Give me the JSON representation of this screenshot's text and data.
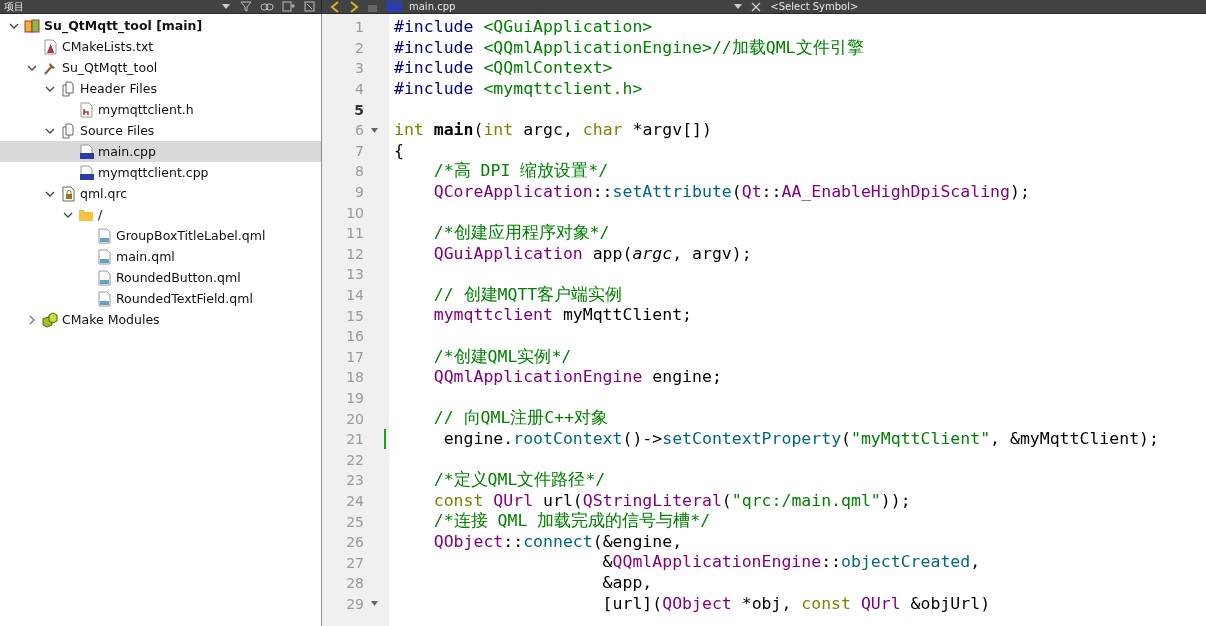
{
  "toolbar": {
    "panel_title": "项目",
    "file_tab": "main.cpp",
    "symbol_selector": "<Select Symbol>"
  },
  "tree": [
    {
      "label": "Su_QtMqtt_tool [main]",
      "kind": "project",
      "expanded": true,
      "selected": false,
      "children": [
        {
          "label": "CMakeLists.txt",
          "kind": "cmake",
          "selected": false
        },
        {
          "label": "Su_QtMqtt_tool",
          "kind": "target",
          "expanded": true,
          "selected": false,
          "children": [
            {
              "label": "Header Files",
              "kind": "group",
              "expanded": true,
              "selected": false,
              "children": [
                {
                  "label": "mymqttclient.h",
                  "kind": "header",
                  "selected": false
                }
              ]
            },
            {
              "label": "Source Files",
              "kind": "group",
              "expanded": true,
              "selected": false,
              "children": [
                {
                  "label": "main.cpp",
                  "kind": "source",
                  "selected": true
                },
                {
                  "label": "mymqttclient.cpp",
                  "kind": "source",
                  "selected": false
                }
              ]
            },
            {
              "label": "qml.qrc",
              "kind": "resource",
              "expanded": true,
              "selected": false,
              "children": [
                {
                  "label": "/",
                  "kind": "folder",
                  "expanded": true,
                  "selected": false,
                  "children": [
                    {
                      "label": "GroupBoxTitleLabel.qml",
                      "kind": "qml",
                      "selected": false
                    },
                    {
                      "label": "main.qml",
                      "kind": "qml",
                      "selected": false
                    },
                    {
                      "label": "RoundedButton.qml",
                      "kind": "qml",
                      "selected": false
                    },
                    {
                      "label": "RoundedTextField.qml",
                      "kind": "qml",
                      "selected": false
                    }
                  ]
                }
              ]
            }
          ]
        },
        {
          "label": "CMake Modules",
          "kind": "modules",
          "expanded": false,
          "selected": false
        }
      ]
    }
  ],
  "code_lines": [
    {
      "number": "1",
      "tokens": [
        {
          "kind": "pre",
          "text": "#include "
        },
        {
          "kind": "str",
          "text": "<QGuiApplication>"
        }
      ]
    },
    {
      "number": "2",
      "tokens": [
        {
          "kind": "pre",
          "text": "#include "
        },
        {
          "kind": "str",
          "text": "<QQmlApplicationEngine>//加载QML文件引擎"
        }
      ]
    },
    {
      "number": "3",
      "tokens": [
        {
          "kind": "pre",
          "text": "#include "
        },
        {
          "kind": "str",
          "text": "<QQmlContext>"
        }
      ]
    },
    {
      "number": "4",
      "tokens": [
        {
          "kind": "pre",
          "text": "#include "
        },
        {
          "kind": "str",
          "text": "<mymqttclient.h>"
        }
      ]
    },
    {
      "number": "5",
      "current": true
    },
    {
      "number": "6",
      "fold": true,
      "tokens": [
        {
          "kind": "kw",
          "text": "int "
        },
        {
          "kind": "bold",
          "text": "main"
        },
        {
          "kind": "plain",
          "text": "("
        },
        {
          "kind": "kw",
          "text": "int"
        },
        {
          "kind": "plain",
          "text": " argc, "
        },
        {
          "kind": "kw",
          "text": "char"
        },
        {
          "kind": "plain",
          "text": " *argv[])"
        }
      ]
    },
    {
      "number": "7",
      "tokens": [
        {
          "kind": "plain",
          "text": "{"
        }
      ]
    },
    {
      "number": "8",
      "tokens": [
        {
          "kind": "comment",
          "text": "    /*高 DPI 缩放设置*/"
        }
      ]
    },
    {
      "number": "9",
      "tokens": [
        {
          "kind": "type",
          "text": "    QCoreApplication"
        },
        {
          "kind": "plain",
          "text": "::"
        },
        {
          "kind": "func",
          "text": "setAttribute"
        },
        {
          "kind": "plain",
          "text": "("
        },
        {
          "kind": "type",
          "text": "Qt"
        },
        {
          "kind": "plain",
          "text": "::"
        },
        {
          "kind": "type",
          "text": "AA_EnableHighDpiScaling"
        },
        {
          "kind": "plain",
          "text": ");"
        }
      ]
    },
    {
      "number": "10"
    },
    {
      "number": "11",
      "tokens": [
        {
          "kind": "comment",
          "text": "    /*创建应用程序对象*/"
        }
      ]
    },
    {
      "number": "12",
      "tokens": [
        {
          "kind": "type",
          "text": "    QGuiApplication"
        },
        {
          "kind": "plain",
          "text": " app("
        },
        {
          "kind": "param",
          "text": "argc"
        },
        {
          "kind": "plain",
          "text": ", argv);"
        }
      ]
    },
    {
      "number": "13"
    },
    {
      "number": "14",
      "tokens": [
        {
          "kind": "comment",
          "text": "    // 创建MQTT客户端实例"
        }
      ]
    },
    {
      "number": "15",
      "tokens": [
        {
          "kind": "type",
          "text": "    mymqttclient"
        },
        {
          "kind": "plain",
          "text": " myMqttClient;"
        }
      ]
    },
    {
      "number": "16"
    },
    {
      "number": "17",
      "tokens": [
        {
          "kind": "comment",
          "text": "    /*创建QML实例*/"
        }
      ]
    },
    {
      "number": "18",
      "tokens": [
        {
          "kind": "type",
          "text": "    QQmlApplicationEngine"
        },
        {
          "kind": "plain",
          "text": " engine;"
        }
      ]
    },
    {
      "number": "19"
    },
    {
      "number": "20",
      "tokens": [
        {
          "kind": "comment",
          "text": "    // 向QML注册C++对象"
        }
      ]
    },
    {
      "number": "21",
      "modified": true,
      "tokens": [
        {
          "kind": "plain",
          "text": "     engine."
        },
        {
          "kind": "func",
          "text": "rootContext"
        },
        {
          "kind": "plain",
          "text": "()->"
        },
        {
          "kind": "func",
          "text": "setContextProperty"
        },
        {
          "kind": "plain",
          "text": "("
        },
        {
          "kind": "str",
          "text": "\"myMqttClient\""
        },
        {
          "kind": "plain",
          "text": ", &myMqttClient);"
        }
      ]
    },
    {
      "number": "22"
    },
    {
      "number": "23",
      "tokens": [
        {
          "kind": "comment",
          "text": "    /*定义QML文件路径*/"
        }
      ]
    },
    {
      "number": "24",
      "tokens": [
        {
          "kind": "kw",
          "text": "    const "
        },
        {
          "kind": "type",
          "text": "QUrl"
        },
        {
          "kind": "plain",
          "text": " url("
        },
        {
          "kind": "type",
          "text": "QStringLiteral"
        },
        {
          "kind": "plain",
          "text": "("
        },
        {
          "kind": "str",
          "text": "\"qrc:/main.qml\""
        },
        {
          "kind": "plain",
          "text": "));"
        }
      ]
    },
    {
      "number": "25",
      "tokens": [
        {
          "kind": "comment",
          "text": "    /*连接 QML 加载完成的信号与槽*/"
        }
      ]
    },
    {
      "number": "26",
      "tokens": [
        {
          "kind": "type",
          "text": "    QObject"
        },
        {
          "kind": "plain",
          "text": "::"
        },
        {
          "kind": "func",
          "text": "connect"
        },
        {
          "kind": "plain",
          "text": "(&engine,"
        }
      ]
    },
    {
      "number": "27",
      "tokens": [
        {
          "kind": "plain",
          "text": "                     &"
        },
        {
          "kind": "type",
          "text": "QQmlApplicationEngine"
        },
        {
          "kind": "plain",
          "text": "::"
        },
        {
          "kind": "func",
          "text": "objectCreated"
        },
        {
          "kind": "plain",
          "text": ","
        }
      ]
    },
    {
      "number": "28",
      "tokens": [
        {
          "kind": "plain",
          "text": "                     &app,"
        }
      ]
    },
    {
      "number": "29",
      "fold": true,
      "tokens": [
        {
          "kind": "plain",
          "text": "                     [url]("
        },
        {
          "kind": "type",
          "text": "QObject"
        },
        {
          "kind": "plain",
          "text": " *obj, "
        },
        {
          "kind": "kw",
          "text": "const "
        },
        {
          "kind": "type",
          "text": "QUrl"
        },
        {
          "kind": "plain",
          "text": " &objUrl)"
        }
      ]
    }
  ]
}
